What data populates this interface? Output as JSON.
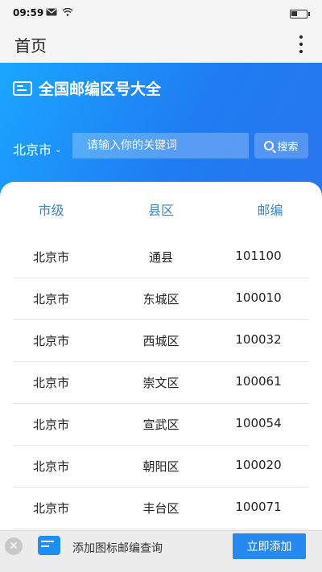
{
  "status_bar": {
    "time": "09:59"
  },
  "app_bar": {
    "title": "首页"
  },
  "hero": {
    "title": "全国邮编区号大全",
    "city": "北京市",
    "search_placeholder": "请输入你的关键词",
    "search_label": "搜索"
  },
  "table": {
    "headers": [
      "市级",
      "县区",
      "邮编"
    ],
    "rows": [
      [
        "北京市",
        "通县",
        "101100"
      ],
      [
        "北京市",
        "东城区",
        "100010"
      ],
      [
        "北京市",
        "西城区",
        "100032"
      ],
      [
        "北京市",
        "崇文区",
        "100061"
      ],
      [
        "北京市",
        "宣武区",
        "100054"
      ],
      [
        "北京市",
        "朝阳区",
        "100020"
      ],
      [
        "北京市",
        "丰台区",
        "100071"
      ]
    ]
  },
  "bottom_bar": {
    "text": "添加图标邮编查询",
    "button_label": "立即添加"
  },
  "colors": {
    "accent": "#2689ef",
    "header_text": "#3a84c9"
  }
}
